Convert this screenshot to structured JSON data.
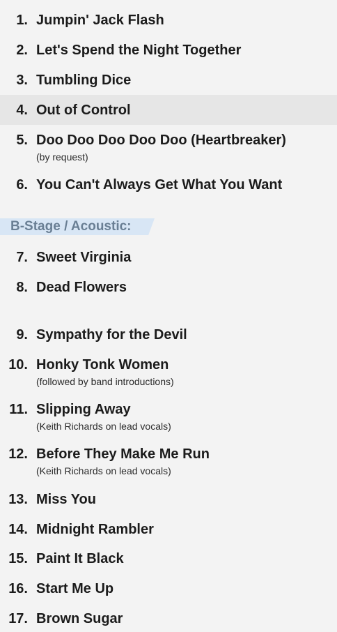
{
  "setlist": {
    "songs": [
      {
        "number": "1.",
        "title": "Jumpin' Jack Flash"
      },
      {
        "number": "2.",
        "title": "Let's Spend the Night Together"
      },
      {
        "number": "3.",
        "title": "Tumbling Dice"
      },
      {
        "number": "4.",
        "title": "Out of Control"
      },
      {
        "number": "5.",
        "title": "Doo Doo Doo Doo Doo (Heartbreaker)",
        "note": "(by request)"
      },
      {
        "number": "6.",
        "title": "You Can't Always Get What You Want"
      },
      {
        "number": "7.",
        "title": "Sweet Virginia"
      },
      {
        "number": "8.",
        "title": "Dead Flowers"
      },
      {
        "number": "9.",
        "title": "Sympathy for the Devil"
      },
      {
        "number": "10.",
        "title": "Honky Tonk Women",
        "note": "(followed by band introductions)"
      },
      {
        "number": "11.",
        "title": "Slipping Away",
        "note": "(Keith Richards on lead vocals)"
      },
      {
        "number": "12.",
        "title": "Before They Make Me Run",
        "note": "(Keith Richards on lead vocals)"
      },
      {
        "number": "13.",
        "title": "Miss You"
      },
      {
        "number": "14.",
        "title": "Midnight Rambler"
      },
      {
        "number": "15.",
        "title": "Paint It Black"
      },
      {
        "number": "16.",
        "title": "Start Me Up"
      },
      {
        "number": "17.",
        "title": "Brown Sugar"
      }
    ],
    "section": {
      "label": "B-Stage / Acoustic:"
    }
  },
  "colors": {
    "background": "#f3f3f3",
    "highlight_row": "#e6e6e6",
    "section_bg": "#d8e6f5",
    "section_text": "#6a7f94",
    "text": "#1b1b1b"
  }
}
